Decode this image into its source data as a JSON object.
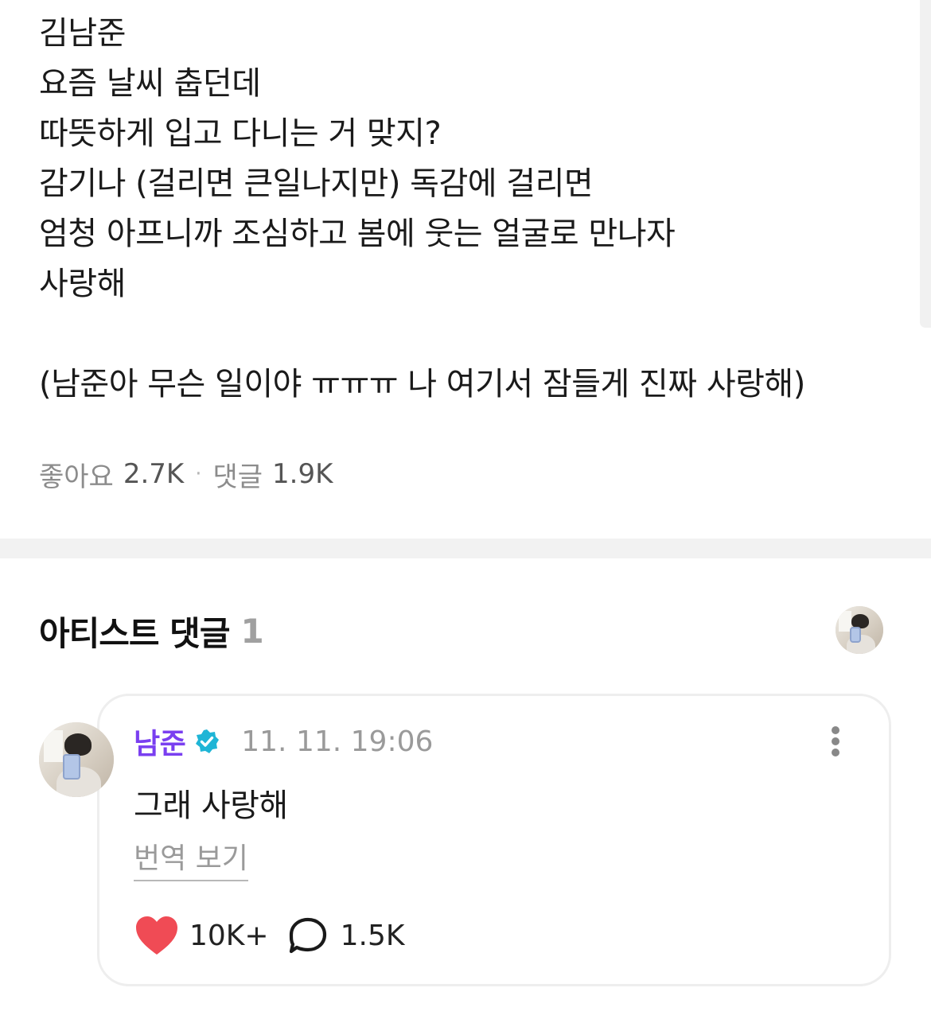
{
  "post": {
    "lines": [
      "김남준",
      "요즘 날씨 춥던데",
      "따뜻하게 입고 다니는 거 맞지?",
      "감기나 (걸리면 큰일나지만) 독감에 걸리면",
      "엄청 아프니까 조심하고 봄에 웃는 얼굴로 만나자",
      "사랑해",
      "(남준아 무슨 일이야 ㅠㅠㅠ 나 여기서 잠들게 진짜 사랑해)"
    ],
    "stats": {
      "likes_label": "좋아요",
      "likes_value": "2.7K",
      "separator": "·",
      "comments_label": "댓글",
      "comments_value": "1.9K"
    }
  },
  "artist_comments": {
    "title": "아티스트 댓글",
    "count": "1",
    "avatar_icon": "artist-avatar-icon",
    "comment": {
      "author": "남준",
      "verified_icon": "verified-badge-icon",
      "timestamp": "11. 11. 19:06",
      "text": "그래 사랑해",
      "translate_label": "번역 보기",
      "likes": "10K+",
      "replies": "1.5K",
      "like_icon": "heart-icon",
      "reply_icon": "speech-bubble-icon",
      "more_icon": "more-vertical-icon"
    }
  },
  "colors": {
    "author_name": "#7a3ff0",
    "verified_badge": "#1fb5d6",
    "heart": "#f04b55",
    "divider": "#f2f2f2"
  }
}
